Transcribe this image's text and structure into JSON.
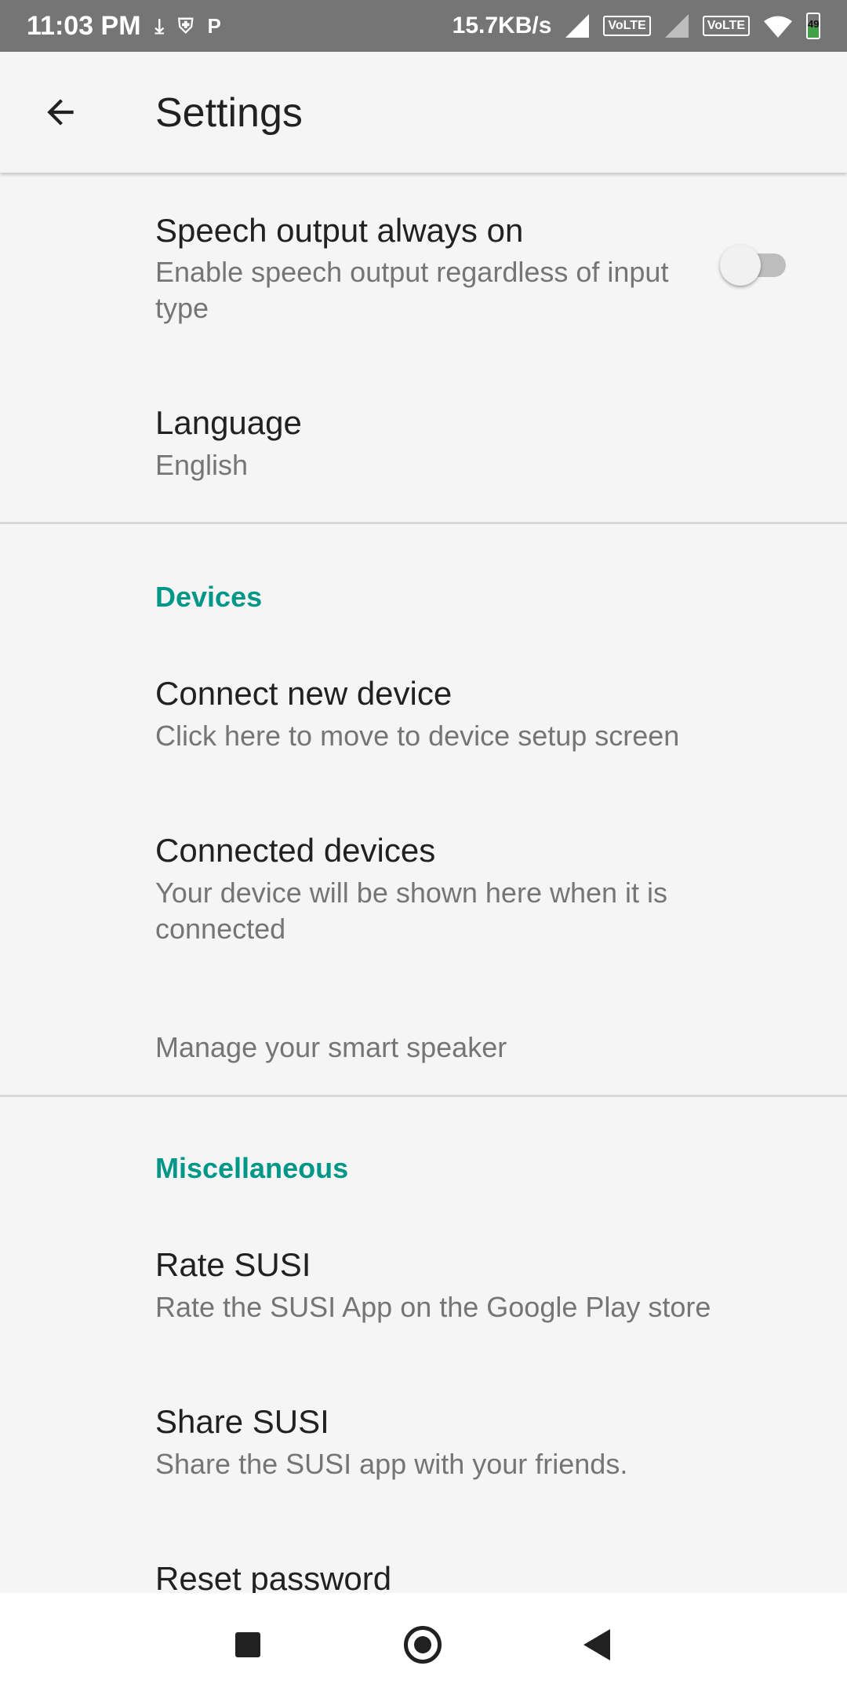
{
  "status_bar": {
    "time": "11:03 PM",
    "speed": "15.7KB/s",
    "volte1": "VoLTE",
    "volte2": "VoLTE",
    "battery_level": "49",
    "icons": [
      "download-icon",
      "shield-icon",
      "p-icon",
      "signal-icon",
      "wifi-icon",
      "battery-icon"
    ]
  },
  "app_bar": {
    "title": "Settings",
    "back_icon": "arrow-back-icon"
  },
  "preferences": {
    "speech_output": {
      "title": "Speech output always on",
      "summary": "Enable speech output regardless of input type",
      "toggle_on": false
    },
    "language": {
      "title": "Language",
      "summary": "English"
    },
    "devices_category": "Devices",
    "connect_new_device": {
      "title": "Connect new device",
      "summary": "Click here to move to device setup screen"
    },
    "connected_devices": {
      "title": "Connected devices",
      "summary": "Your device will be shown here when it is connected"
    },
    "manage_speaker": {
      "summary": "Manage your smart speaker"
    },
    "misc_category": "Miscellaneous",
    "rate_susi": {
      "title": "Rate SUSI",
      "summary": "Rate the SUSI App on the Google Play store"
    },
    "share_susi": {
      "title": "Share SUSI",
      "summary": "Share the SUSI app with your friends."
    },
    "reset_password": {
      "title": "Reset password"
    }
  },
  "nav_bar": {
    "icons": [
      "recents-icon",
      "home-icon",
      "back-icon"
    ]
  },
  "colors": {
    "accent": "#009688",
    "background": "#f5f5f5",
    "status_bar": "#757575"
  }
}
